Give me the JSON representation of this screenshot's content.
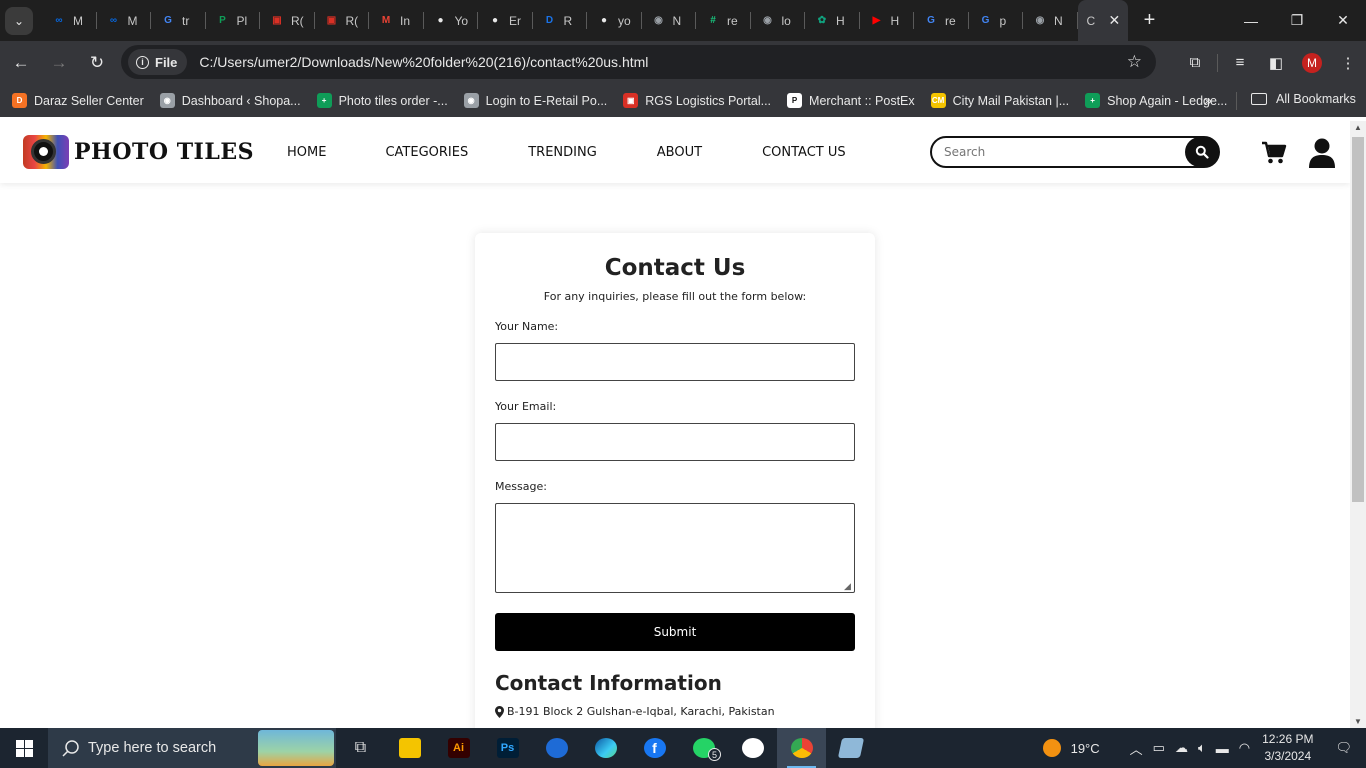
{
  "browser": {
    "tabs": [
      {
        "label": "M",
        "fav_color": "#0668e1",
        "fav_glyph": "∞"
      },
      {
        "label": "M",
        "fav_color": "#0668e1",
        "fav_glyph": "∞"
      },
      {
        "label": "tr",
        "fav_color": "#4285f4",
        "fav_glyph": "G"
      },
      {
        "label": "Pl",
        "fav_color": "#0f9d58",
        "fav_glyph": "P"
      },
      {
        "label": "R(",
        "fav_color": "#d93025",
        "fav_glyph": "▣"
      },
      {
        "label": "R(",
        "fav_color": "#d93025",
        "fav_glyph": "▣"
      },
      {
        "label": "In",
        "fav_color": "#ea4335",
        "fav_glyph": "M"
      },
      {
        "label": "Yo",
        "fav_color": "#e8e8e8",
        "fav_glyph": "●"
      },
      {
        "label": "Er",
        "fav_color": "#e8e8e8",
        "fav_glyph": "●"
      },
      {
        "label": "R",
        "fav_color": "#1a73e8",
        "fav_glyph": "D"
      },
      {
        "label": "yo",
        "fav_color": "#e8e8e8",
        "fav_glyph": "●"
      },
      {
        "label": "N",
        "fav_color": "#9aa0a6",
        "fav_glyph": "◉"
      },
      {
        "label": "re",
        "fav_color": "#19c37d",
        "fav_glyph": "#"
      },
      {
        "label": "lo",
        "fav_color": "#9aa0a6",
        "fav_glyph": "◉"
      },
      {
        "label": "H",
        "fav_color": "#10a37f",
        "fav_glyph": "✿"
      },
      {
        "label": "H",
        "fav_color": "#ff0000",
        "fav_glyph": "▶"
      },
      {
        "label": "re",
        "fav_color": "#4285f4",
        "fav_glyph": "G"
      },
      {
        "label": "p",
        "fav_color": "#4285f4",
        "fav_glyph": "G"
      },
      {
        "label": "N",
        "fav_color": "#9aa0a6",
        "fav_glyph": "◉"
      }
    ],
    "active_tab_label": "C",
    "url_chip": "File",
    "url": "C:/Users/umer2/Downloads/New%20folder%20(216)/contact%20us.html",
    "profile_initial": "M",
    "bookmarks": [
      {
        "label": "Daraz Seller Center",
        "color": "#f57224",
        "glyph": "D"
      },
      {
        "label": "Dashboard ‹ Shopa...",
        "color": "#9aa0a6",
        "glyph": "◉"
      },
      {
        "label": "Photo tiles order -...",
        "color": "#0f9d58",
        "glyph": "+"
      },
      {
        "label": "Login to E-Retail Po...",
        "color": "#9aa0a6",
        "glyph": "◉"
      },
      {
        "label": "RGS Logistics Portal...",
        "color": "#d93025",
        "glyph": "▣"
      },
      {
        "label": "Merchant :: PostEx",
        "color": "#ffffff",
        "glyph": "P"
      },
      {
        "label": "City Mail Pakistan |...",
        "color": "#f4c400",
        "glyph": "CM"
      },
      {
        "label": "Shop Again - Ledge...",
        "color": "#0f9d58",
        "glyph": "+"
      }
    ],
    "more_bookmarks": "»",
    "all_bookmarks": "All Bookmarks"
  },
  "site": {
    "logo_text": "PHOTO TILES",
    "nav": [
      "HOME",
      "CATEGORIES",
      "TRENDING",
      "ABOUT",
      "CONTACT US"
    ],
    "search_placeholder": "Search"
  },
  "contact": {
    "title": "Contact Us",
    "subtitle": "For any inquiries, please fill out the form below:",
    "name_label": "Your Name:",
    "email_label": "Your Email:",
    "message_label": "Message:",
    "submit_label": "Submit",
    "info_title": "Contact Information",
    "address": "B-191 Block 2 Gulshan-e-Iqbal, Karachi, Pakistan"
  },
  "taskbar": {
    "search_placeholder": "Type here to search",
    "whatsapp_badge": "5",
    "temperature": "19°C",
    "time": "12:26 PM",
    "date": "3/3/2024"
  }
}
